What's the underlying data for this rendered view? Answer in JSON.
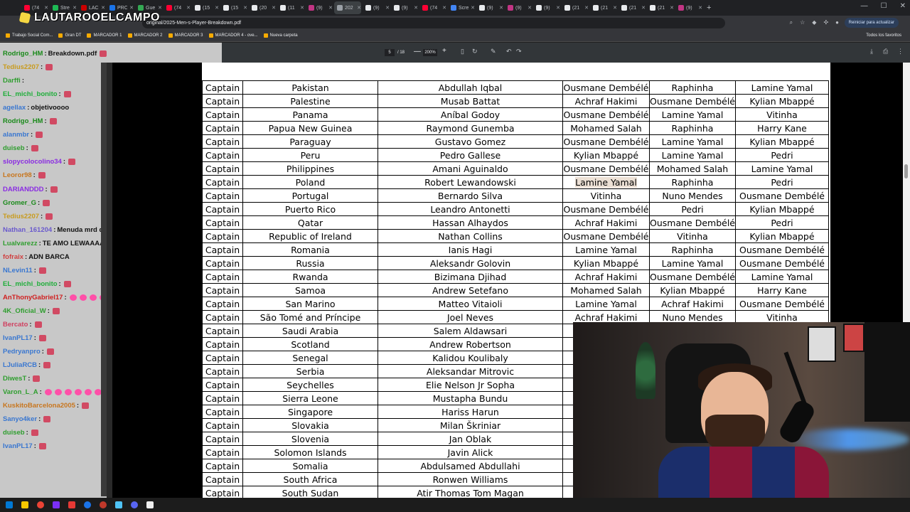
{
  "browser": {
    "tabs": [
      {
        "label": "(74",
        "color": "#ff0033"
      },
      {
        "label": "Stre",
        "color": "#1db954"
      },
      {
        "label": "LAC",
        "color": "#cc0000"
      },
      {
        "label": "PRC",
        "color": "#1a73e8"
      },
      {
        "label": "Gue",
        "color": "#34a853"
      },
      {
        "label": "(74",
        "color": "#ff0033"
      },
      {
        "label": "(15",
        "color": "#e8eaed"
      },
      {
        "label": "(15",
        "color": "#e8eaed"
      },
      {
        "label": "(20",
        "color": "#e8eaed"
      },
      {
        "label": "(11",
        "color": "#e8eaed"
      },
      {
        "label": "(9)",
        "color": "#c13584"
      },
      {
        "label": "202",
        "color": "#9aa0a6",
        "active": true
      },
      {
        "label": "(9)",
        "color": "#e8eaed"
      },
      {
        "label": "(9)",
        "color": "#e8eaed"
      },
      {
        "label": "(74",
        "color": "#ff0033"
      },
      {
        "label": "Scre",
        "color": "#4285f4"
      },
      {
        "label": "(9)",
        "color": "#e8eaed"
      },
      {
        "label": "(9)",
        "color": "#c13584"
      },
      {
        "label": "(9)",
        "color": "#e8eaed"
      },
      {
        "label": "(21",
        "color": "#e8eaed"
      },
      {
        "label": "(21",
        "color": "#e8eaed"
      },
      {
        "label": "(21",
        "color": "#e8eaed"
      },
      {
        "label": "(21",
        "color": "#e8eaed"
      },
      {
        "label": "(9)",
        "color": "#c13584"
      }
    ],
    "new_tab": "+",
    "window_controls": {
      "minimize": "—",
      "maximize": "☐",
      "close": "✕"
    },
    "address": "original/2025-Men-s-Player-Breakdown.pdf",
    "update_button": "Reiniciar para actualizar",
    "bookmarks": [
      "Trabajo Social Com...",
      "Gran DT",
      "MARCADOR 1",
      "MARCADOR 2",
      "MARCADOR 3",
      "MARCADOR 4 - ove...",
      "Nueva carpeta"
    ],
    "bookmarks_right": "Todos los favoritos"
  },
  "logo": {
    "text": "LAUTAROOELCAMPO"
  },
  "pdf_toolbar": {
    "page_current": "5",
    "page_total": "/ 18",
    "zoom": "200%",
    "minus": "—",
    "plus": "+"
  },
  "chat": {
    "lines": [
      {
        "user": "Rodrigo_HM",
        "color": "#1a8a1a",
        "text": "Breakdown.pdf",
        "emotes": 1
      },
      {
        "user": "Tedius2207",
        "color": "#c89b1e",
        "text": "",
        "emotes": 1
      },
      {
        "user": "Darffi",
        "color": "#2f9e2f",
        "text": "",
        "emotes": 0
      },
      {
        "user": "EL_michi_bonito",
        "color": "#1fae3a",
        "text": "",
        "emotes": 1
      },
      {
        "user": "agellax",
        "color": "#3a77d0",
        "text": "objetivoooo",
        "emotes": 0
      },
      {
        "user": "Rodrigo_HM",
        "color": "#1a8a1a",
        "text": "",
        "emotes": 1
      },
      {
        "user": "alanmbr",
        "color": "#3a77d0",
        "text": "",
        "emotes": 1
      },
      {
        "user": "duiseb",
        "color": "#2f9e2f",
        "text": "",
        "emotes": 1
      },
      {
        "user": "slopycolocolino34",
        "color": "#8a2be2",
        "text": "",
        "emotes": 1
      },
      {
        "user": "Leoror98",
        "color": "#c8761e",
        "text": "",
        "emotes": 1
      },
      {
        "user": "DARIANDDD",
        "color": "#8a2be2",
        "text": "",
        "emotes": 1
      },
      {
        "user": "Gromer_G",
        "color": "#1a8a1a",
        "text": "",
        "emotes": 1
      },
      {
        "user": "Tedius2207",
        "color": "#c89b1e",
        "text": "",
        "emotes": 1
      },
      {
        "user": "Nathan_161204",
        "color": "#6a5acd",
        "text": "Menuda mrd de top",
        "emotes": 0
      },
      {
        "user": "Lualvarezz",
        "color": "#2f9e2f",
        "text": "TE AMO LEWAAAA",
        "emotes": 0
      },
      {
        "user": "fofraix",
        "color": "#d04040",
        "text": "ADN BARCA",
        "emotes": 0
      },
      {
        "user": "NLevin11",
        "color": "#3a77d0",
        "text": "",
        "emotes": 1
      },
      {
        "user": "EL_michi_bonito",
        "color": "#1fae3a",
        "text": "",
        "emotes": 1
      },
      {
        "user": "AnThonyGabriel17",
        "color": "#d02020",
        "text": "",
        "emotes": 8
      },
      {
        "user": "4K_Oficial_W",
        "color": "#2f9e2f",
        "text": "",
        "emotes": 1
      },
      {
        "user": "Bercato",
        "color": "#d04060",
        "text": "",
        "emotes": 1
      },
      {
        "user": "IvanPL17",
        "color": "#3a77d0",
        "text": "",
        "emotes": 1
      },
      {
        "user": "Pedryanpro",
        "color": "#3a77d0",
        "text": "",
        "emotes": 1
      },
      {
        "user": "LJuliaRCB",
        "color": "#3a77d0",
        "text": "",
        "emotes": 1
      },
      {
        "user": "DiwesT",
        "color": "#2f9e2f",
        "text": "",
        "emotes": 1
      },
      {
        "user": "Varon_L_A",
        "color": "#2f9e2f",
        "text": "",
        "emotes": 7
      },
      {
        "user": "KuskitoBarcelona2005",
        "color": "#c8761e",
        "text": "",
        "emotes": 1
      },
      {
        "user": "Sanyo4ker",
        "color": "#3a77d0",
        "text": "",
        "emotes": 1
      },
      {
        "user": "duiseb",
        "color": "#2f9e2f",
        "text": "",
        "emotes": 1
      },
      {
        "user": "IvanPL17",
        "color": "#3a77d0",
        "text": "",
        "emotes": 1
      }
    ]
  },
  "table": {
    "label": "Captain",
    "highlight": {
      "row": 7,
      "col": 3
    },
    "rows": [
      [
        "Pakistan",
        "Abdullah Iqbal",
        "Ousmane Dembélé",
        "Raphinha",
        "Lamine Yamal"
      ],
      [
        "Palestine",
        "Musab Battat",
        "Achraf Hakimi",
        "Ousmane Dembélé",
        "Kylian Mbappé"
      ],
      [
        "Panama",
        "Aníbal Godoy",
        "Ousmane Dembélé",
        "Lamine Yamal",
        "Vitinha"
      ],
      [
        "Papua New Guinea",
        "Raymond Gunemba",
        "Mohamed Salah",
        "Raphinha",
        "Harry Kane"
      ],
      [
        "Paraguay",
        "Gustavo Gomez",
        "Ousmane Dembélé",
        "Lamine Yamal",
        "Kylian Mbappé"
      ],
      [
        "Peru",
        "Pedro Gallese",
        "Kylian Mbappé",
        "Lamine Yamal",
        "Pedri"
      ],
      [
        "Philippines",
        "Amani Aguinaldo",
        "Ousmane Dembélé",
        "Mohamed Salah",
        "Lamine Yamal"
      ],
      [
        "Poland",
        "Robert Lewandowski",
        "Lamine Yamal",
        "Raphinha",
        "Pedri"
      ],
      [
        "Portugal",
        "Bernardo Silva",
        "Vitinha",
        "Nuno Mendes",
        "Ousmane Dembélé"
      ],
      [
        "Puerto Rico",
        "Leandro Antonetti",
        "Ousmane Dembélé",
        "Pedri",
        "Kylian Mbappé"
      ],
      [
        "Qatar",
        "Hassan Alhaydos",
        "Achraf Hakimi",
        "Ousmane Dembélé",
        "Pedri"
      ],
      [
        "Republic of Ireland",
        "Nathan Collins",
        "Ousmane Dembélé",
        "Vitinha",
        "Kylian Mbappé"
      ],
      [
        "Romania",
        "Ianis Hagi",
        "Lamine Yamal",
        "Raphinha",
        "Ousmane Dembélé"
      ],
      [
        "Russia",
        "Aleksandr Golovin",
        "Kylian Mbappé",
        "Lamine Yamal",
        "Ousmane Dembélé"
      ],
      [
        "Rwanda",
        "Bizimana Djihad",
        "Achraf Hakimi",
        "Ousmane Dembélé",
        "Lamine Yamal"
      ],
      [
        "Samoa",
        "Andrew Setefano",
        "Mohamed Salah",
        "Kylian Mbappé",
        "Harry Kane"
      ],
      [
        "San Marino",
        "Matteo Vitaioli",
        "Lamine Yamal",
        "Achraf Hakimi",
        "Ousmane Dembélé"
      ],
      [
        "São Tomé and Príncipe",
        "Joel Neves",
        "Achraf Hakimi",
        "Nuno Mendes",
        "Vitinha"
      ],
      [
        "Saudi Arabia",
        "Salem Aldawsari",
        "Ou",
        "",
        ""
      ],
      [
        "Scotland",
        "Andrew Robertson",
        "N",
        "",
        ""
      ],
      [
        "Senegal",
        "Kalidou Koulibaly",
        "Ou",
        "",
        ""
      ],
      [
        "Serbia",
        "Aleksandar Mitrovic",
        "Ou",
        "",
        ""
      ],
      [
        "Seychelles",
        "Elie Nelson Jr Sopha",
        "",
        "",
        ""
      ],
      [
        "Sierra Leone",
        "Mustapha Bundu",
        "Ou",
        "",
        ""
      ],
      [
        "Singapore",
        "Hariss Harun",
        "Ou",
        "",
        ""
      ],
      [
        "Slovakia",
        "Milan Škriniar",
        "Ou",
        "",
        ""
      ],
      [
        "Slovenia",
        "Jan Oblak",
        "Ou",
        "",
        ""
      ],
      [
        "Solomon Islands",
        "Javin Alick",
        "",
        "",
        ""
      ],
      [
        "Somalia",
        "Abdulsamed Abdullahi",
        "Ou",
        "",
        ""
      ],
      [
        "South Africa",
        "Ronwen Williams",
        "Ou",
        "",
        ""
      ],
      [
        "South Sudan",
        "Atir Thomas Tom Magan",
        "",
        "",
        ""
      ]
    ]
  }
}
